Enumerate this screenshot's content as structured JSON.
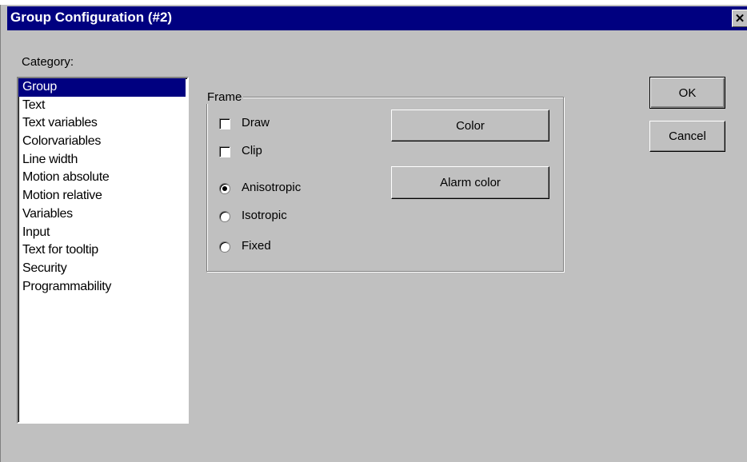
{
  "window": {
    "title": "Group Configuration (#2)",
    "close_glyph": "✕"
  },
  "category_label": "Category:",
  "categories": [
    "Group",
    "Text",
    "Text variables",
    "Colorvariables",
    "Line width",
    "Motion absolute",
    "Motion relative",
    "Variables",
    "Input",
    "Text for tooltip",
    "Security",
    "Programmability"
  ],
  "selected_category": "Group",
  "frame": {
    "legend": "Frame",
    "draw_label": "Draw",
    "draw_checked": false,
    "clip_label": "Clip",
    "clip_checked": false,
    "aspect_options": [
      "Anisotropic",
      "Isotropic",
      "Fixed"
    ],
    "aspect_selected": "Anisotropic",
    "color_button": "Color",
    "alarm_color_button": "Alarm color"
  },
  "buttons": {
    "ok": "OK",
    "cancel": "Cancel"
  },
  "colors": {
    "titlebar": "#000080",
    "face": "#c0c0c0",
    "selection": "#000080"
  },
  "icons": {
    "close": "close-icon"
  }
}
